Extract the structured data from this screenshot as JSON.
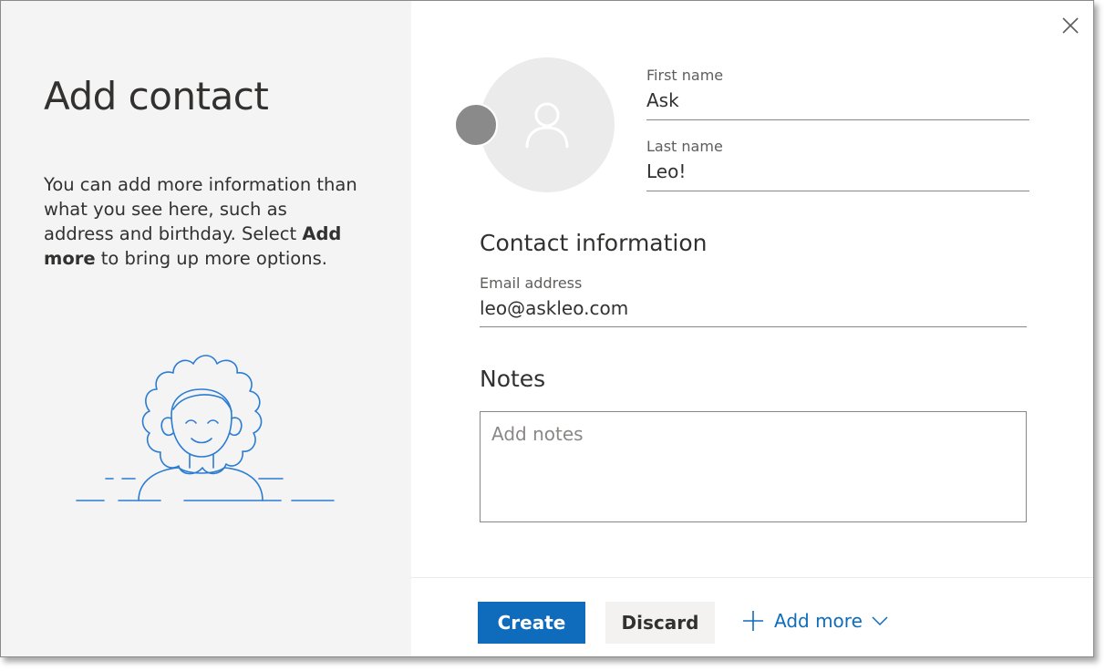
{
  "panel": {
    "title": "Add contact",
    "description_part1": "You can add more information than what you see here, such as address and birthday. Select ",
    "description_bold": "Add more",
    "description_part2": " to bring up more options."
  },
  "form": {
    "first_name_label": "First name",
    "first_name_value": "Ask",
    "last_name_label": "Last name",
    "last_name_value": "Leo!",
    "contact_heading": "Contact information",
    "email_label": "Email address",
    "email_value": "leo@askleo.com",
    "notes_heading": "Notes",
    "notes_placeholder": "Add notes"
  },
  "footer": {
    "create_label": "Create",
    "discard_label": "Discard",
    "add_more_label": "Add more"
  },
  "colors": {
    "accent": "#0f6cbd",
    "panel_bg": "#f4f4f4",
    "illustration": "#2b7cd3"
  },
  "icons": {
    "close": "close-icon",
    "avatar": "person-icon",
    "add": "plus-icon",
    "dropdown": "chevron-down-icon"
  }
}
